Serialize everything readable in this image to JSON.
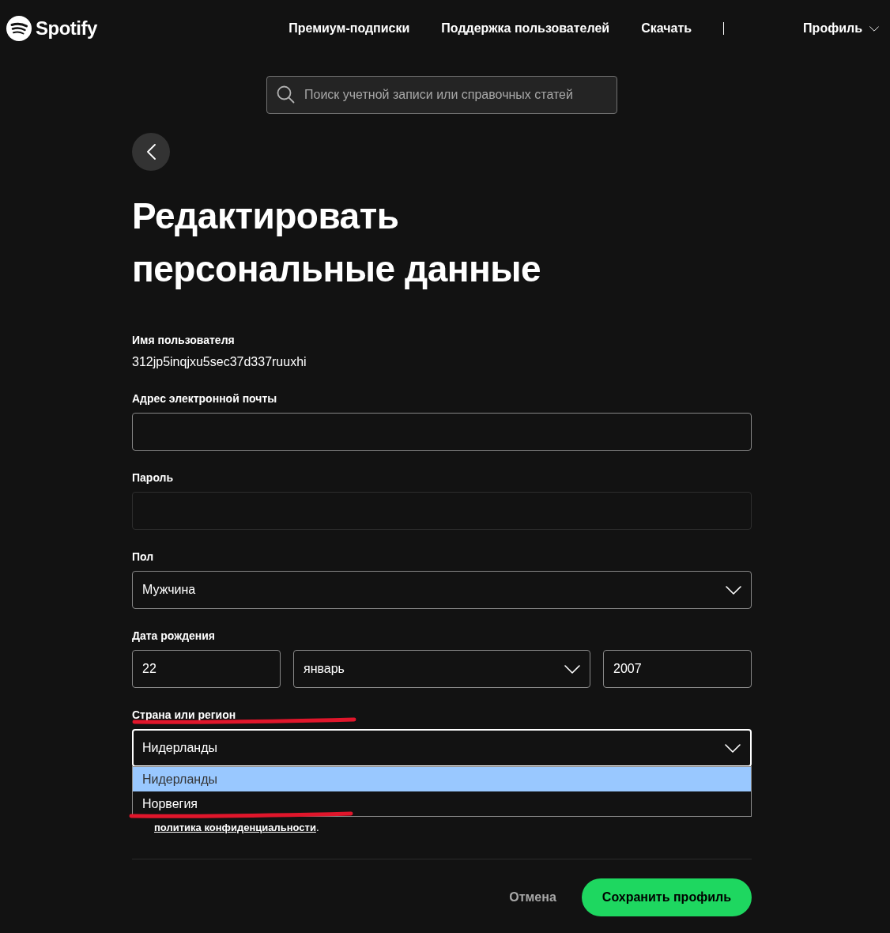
{
  "header": {
    "logo": "Spotify",
    "nav": [
      {
        "label": "Премиум-подписки"
      },
      {
        "label": "Поддержка пользователей"
      },
      {
        "label": "Скачать"
      }
    ],
    "profile": "Профиль"
  },
  "search": {
    "placeholder": "Поиск учетной записи или справочных статей"
  },
  "title": "Редактировать персональные данные",
  "fields": [
    {
      "kind": "static",
      "label": "Имя пользователя",
      "value": "312jp5inqjxu5sec37d337ruuxhi",
      "underlined": false
    },
    {
      "kind": "input",
      "label": "Адрес электронной почты",
      "disabled": false,
      "underlined": false
    },
    {
      "kind": "input",
      "label": "Пароль",
      "disabled": true,
      "underlined": false
    },
    {
      "kind": "select",
      "label": "Пол",
      "value": "Мужчина",
      "expanded": false,
      "underlined": false
    },
    {
      "kind": "date",
      "label": "Дата рождения",
      "day": "22",
      "month": "январь",
      "year": "2007",
      "underlined": false
    },
    {
      "kind": "select",
      "label": "Страна или регион",
      "value": "Нидерланды",
      "expanded": true,
      "underlined": true,
      "options": [
        {
          "label": "Нидерланды",
          "selected": true,
          "underlined": false
        },
        {
          "label": "Норвегия",
          "selected": false,
          "underlined": true
        }
      ]
    }
  ],
  "consent": {
    "link": "политика конфиденциальности",
    "tail": "."
  },
  "buttons": [
    {
      "kind": "text",
      "label": "Отмена"
    },
    {
      "kind": "primary",
      "label": "Сохранить профиль"
    }
  ]
}
